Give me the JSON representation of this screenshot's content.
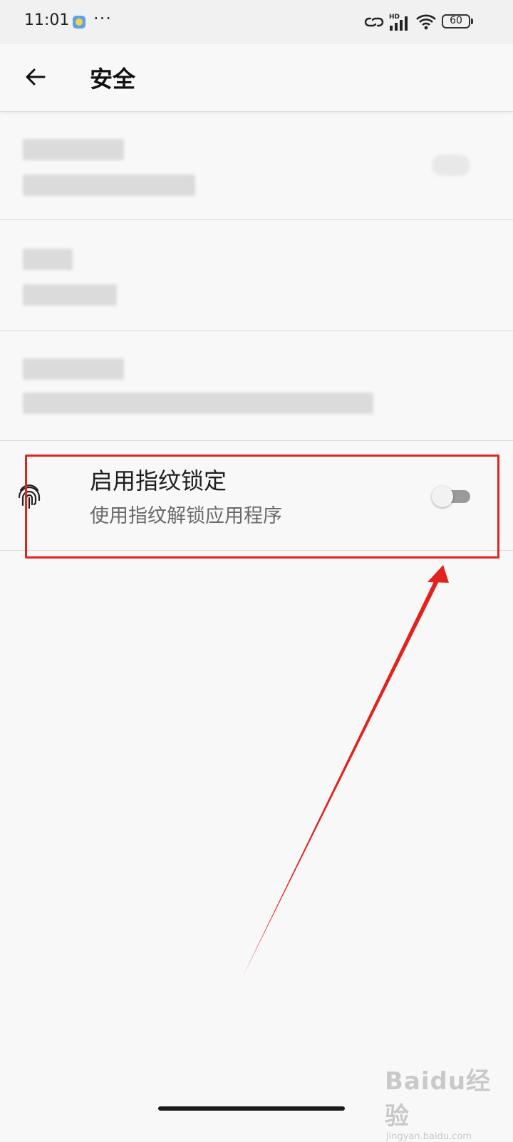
{
  "status_bar": {
    "time": "11:01",
    "more": "···",
    "hd": "HD",
    "battery": "60"
  },
  "header": {
    "title": "安全",
    "back_icon": "arrow-left-icon"
  },
  "settings": {
    "blurred_item_count": 3,
    "fingerprint_item": {
      "icon": "fingerprint-icon",
      "title": "启用指纹锁定",
      "subtitle": "使用指纹解锁应用程序",
      "enabled": false
    }
  },
  "watermark": {
    "brand": "Baidu经验",
    "url": "jingyan.baidu.com"
  },
  "colors": {
    "background": "#f8f8f8",
    "highlight": "#e0231f",
    "toggle_off": "#9a9a9a"
  }
}
